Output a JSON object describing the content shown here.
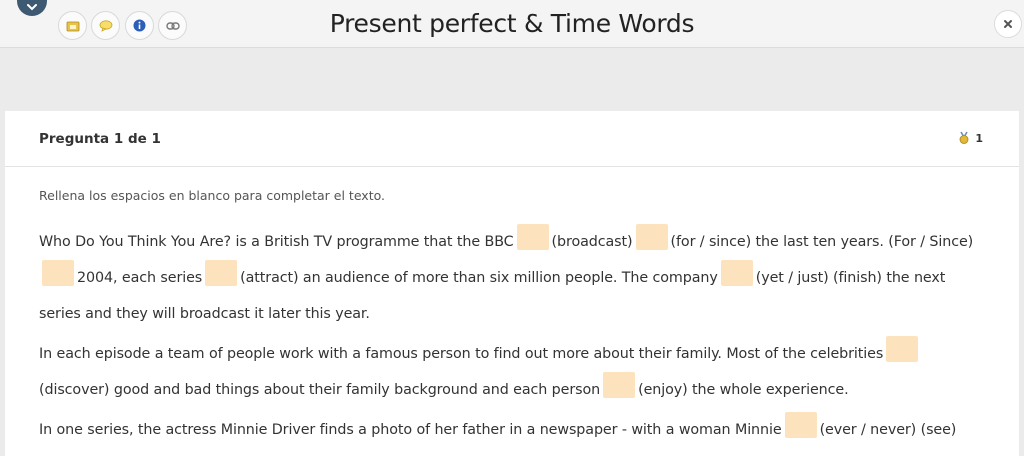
{
  "header": {
    "title": "Present perfect & Time Words",
    "tools": [
      {
        "name": "folder-note-icon"
      },
      {
        "name": "comment-icon"
      },
      {
        "name": "info-icon"
      },
      {
        "name": "link-icon"
      }
    ]
  },
  "question": {
    "counter": "Pregunta 1 de 1",
    "points": "1",
    "instruction": "Rellena los espacios en blanco para completar el texto."
  },
  "paragraphs": [
    {
      "segments": [
        {
          "t": "Who Do You Think You Are? is a British TV programme that the BBC"
        },
        {
          "blank": true
        },
        {
          "t": "(broadcast)"
        },
        {
          "blank": true
        },
        {
          "t": "(for / since) the last ten years. (For / Since)"
        },
        {
          "blank": true
        },
        {
          "t": "2004, each series"
        },
        {
          "blank": true
        },
        {
          "t": "(attract) an audience of more than six million people. The company"
        },
        {
          "blank": true
        },
        {
          "t": "(yet / just) (finish) the next series and they will broadcast it later this year."
        }
      ]
    },
    {
      "segments": [
        {
          "t": "In each episode a team of people work with a famous person to find out more about their family. Most of the celebrities"
        },
        {
          "blank": true
        },
        {
          "t": "(discover) good and bad things about their family background and each person"
        },
        {
          "blank": true
        },
        {
          "t": "(enjoy) the whole experience."
        }
      ]
    },
    {
      "segments": [
        {
          "t": "In one series, the actress Minnie Driver finds a photo of her father in a newspaper - with a woman Minnie"
        },
        {
          "blank": true
        },
        {
          "t": "(ever / never) (see)"
        }
      ]
    }
  ],
  "colors": {
    "accent": "#3e5a72",
    "blank_fill": "#fde3bd",
    "background": "#ebebeb"
  }
}
